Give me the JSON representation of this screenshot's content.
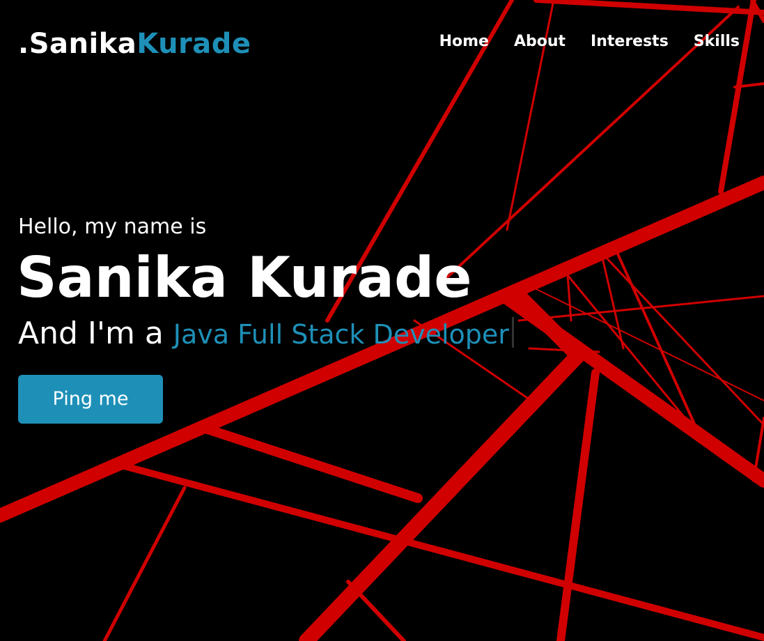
{
  "brand": {
    "prefix": ".Sanika",
    "accent": "Kurade",
    "accent_color": "#1e90b8"
  },
  "nav": {
    "items": [
      {
        "label": "Home"
      },
      {
        "label": "About"
      },
      {
        "label": "Interests"
      },
      {
        "label": "Skills"
      }
    ]
  },
  "hero": {
    "greeting": "Hello, my name is",
    "name": "Sanika Kurade",
    "role_prefix": "And I'm a",
    "role_typed": "Java Full Stack Developer",
    "cta_label": "Ping me"
  },
  "theme": {
    "background": "#000000",
    "lines": "#d00000",
    "text": "#ffffff",
    "accent": "#1e90b8"
  }
}
